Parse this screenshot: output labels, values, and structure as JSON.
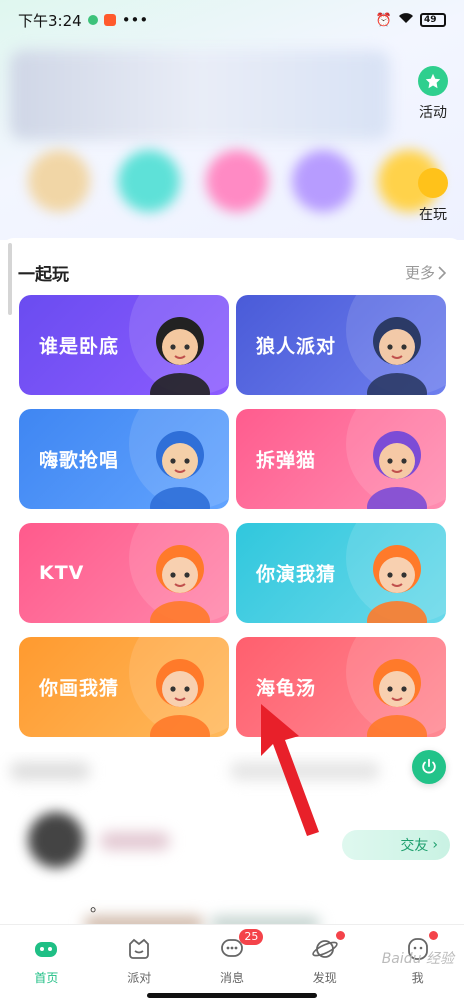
{
  "status_bar": {
    "time": "下午3:24",
    "dots": "•••",
    "battery": "49"
  },
  "side_buttons": {
    "activity": "活动",
    "playing": "在玩"
  },
  "section": {
    "title": "一起玩",
    "more": "更多"
  },
  "games": [
    {
      "label": "谁是卧底",
      "color_from": "#6a4cf0",
      "color_to": "#8c5cff"
    },
    {
      "label": "狼人派对",
      "color_from": "#4a5bd8",
      "color_to": "#6e7fee"
    },
    {
      "label": "嗨歌抢唱",
      "color_from": "#3f86f2",
      "color_to": "#62a4ff"
    },
    {
      "label": "拆弹猫",
      "color_from": "#ff5c8e",
      "color_to": "#ff8db1"
    },
    {
      "label": "KTV",
      "color_from": "#ff5a8c",
      "color_to": "#ff87ab"
    },
    {
      "label": "你演我猜",
      "color_from": "#30c7dd",
      "color_to": "#6ad9ea"
    },
    {
      "label": "你画我猜",
      "color_from": "#ff9a2f",
      "color_to": "#ffb95c"
    },
    {
      "label": "海龟汤",
      "color_from": "#ff5f6e",
      "color_to": "#ff8a94"
    }
  ],
  "feed": {
    "friend_button": "交友",
    "dot_text": "。"
  },
  "bottom_nav": [
    {
      "label": "首页",
      "icon": "home-gamepad-icon",
      "active": true
    },
    {
      "label": "派对",
      "icon": "party-icon",
      "active": false
    },
    {
      "label": "消息",
      "icon": "message-icon",
      "active": false,
      "badge": "25"
    },
    {
      "label": "发现",
      "icon": "planet-icon",
      "active": false,
      "dot": true
    },
    {
      "label": "我",
      "icon": "profile-icon",
      "active": false,
      "dot": true
    }
  ],
  "watermark": "Baidu 经验",
  "colors": {
    "accent": "#1fbf85",
    "badge": "#f4434a",
    "arrow": "#e8202a"
  }
}
